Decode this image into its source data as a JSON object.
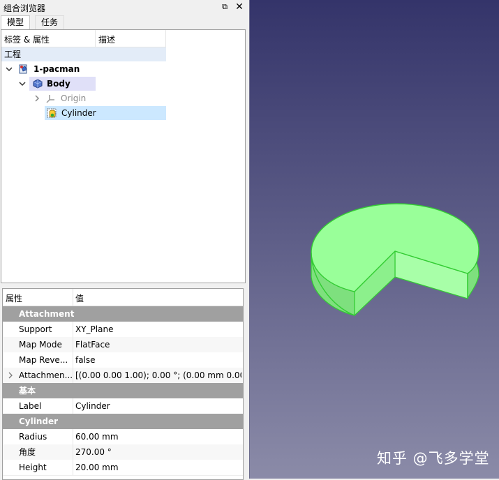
{
  "panel": {
    "title": "组合浏览器",
    "float_icon": "⧉",
    "close_icon": "✕"
  },
  "tabs": [
    {
      "label": "模型"
    },
    {
      "label": "任务"
    }
  ],
  "tree": {
    "headers": {
      "label": "标签 & 属性",
      "description": "描述"
    },
    "project_label": "工程",
    "items": {
      "pacman": "1-pacman",
      "body": "Body",
      "origin": "Origin",
      "cylinder": "Cylinder"
    }
  },
  "properties": {
    "headers": {
      "name": "属性",
      "value": "值"
    },
    "groups": {
      "attachment": "Attachment",
      "base": "基本",
      "cylinder": "Cylinder"
    },
    "rows": {
      "support": {
        "name": "Support",
        "value": "XY_Plane"
      },
      "map_mode": {
        "name": "Map Mode",
        "value": "FlatFace"
      },
      "map_reversed": {
        "name": "Map Reve...",
        "value": "false"
      },
      "attachment_offset": {
        "name": "Attachmen...",
        "value": "[(0.00 0.00 1.00); 0.00 °; (0.00 mm  0.00..."
      },
      "label": {
        "name": "Label",
        "value": "Cylinder"
      },
      "radius": {
        "name": "Radius",
        "value": "60.00 mm"
      },
      "angle": {
        "name": "角度",
        "value": "270.00 °"
      },
      "height": {
        "name": "Height",
        "value": "20.00 mm"
      }
    }
  },
  "view": {
    "watermark": "知乎 @飞多学堂"
  },
  "colors": {
    "selection": "#cce8ff",
    "body_highlight": "#e0e0f8",
    "solid_green": "#99ff99",
    "edge_green": "#33dd33",
    "group_gray": "#a0a0a0"
  }
}
